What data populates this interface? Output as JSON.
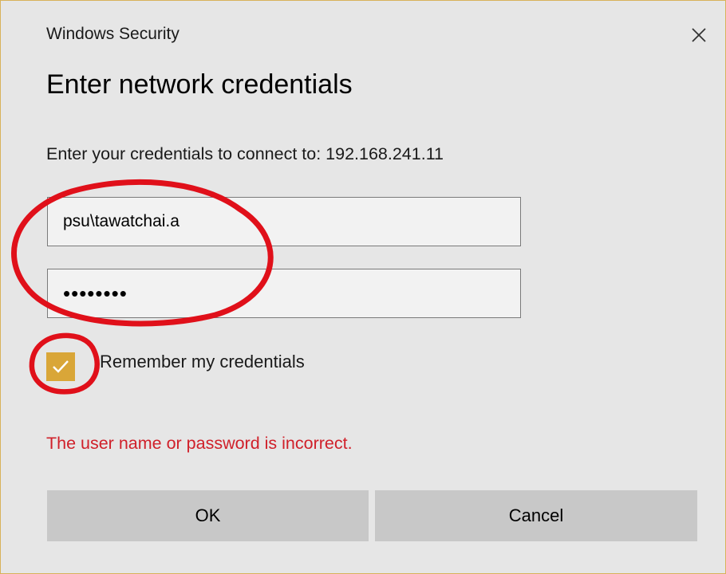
{
  "window": {
    "title": "Windows Security",
    "close_icon": "close-icon"
  },
  "main": {
    "heading": "Enter network credentials",
    "description": "Enter your credentials to connect to: 192.168.241.11",
    "username_value": "psu\\tawatchai.a",
    "password_value": "••••••••",
    "remember_label": "Remember my credentials",
    "remember_checked": true,
    "error_message": "The user name or password is incorrect."
  },
  "buttons": {
    "ok_label": "OK",
    "cancel_label": "Cancel"
  },
  "colors": {
    "dialog_bg": "#e6e6e6",
    "border_accent": "#d9b25a",
    "checkbox_fill": "#d9a638",
    "error_text": "#d0202a",
    "button_bg": "#c8c8c8",
    "annotation_red": "#e0101a"
  }
}
